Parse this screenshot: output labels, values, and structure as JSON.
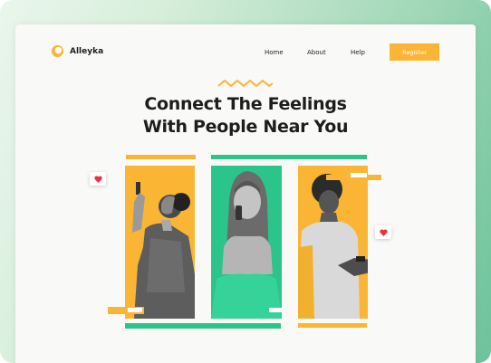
{
  "brand": {
    "name": "Alleyka"
  },
  "nav": {
    "items": [
      "Home",
      "About",
      "Help"
    ],
    "register": "Register"
  },
  "hero": {
    "line1": "Connect The Feelings",
    "line2": "With People Near You"
  },
  "colors": {
    "yellow": "#fbb534",
    "green": "#2bc48a",
    "heart": "#e8333b",
    "bg": "#f9f9f8"
  },
  "icons": [
    "logo-icon",
    "squiggle-icon",
    "heart-icon"
  ]
}
